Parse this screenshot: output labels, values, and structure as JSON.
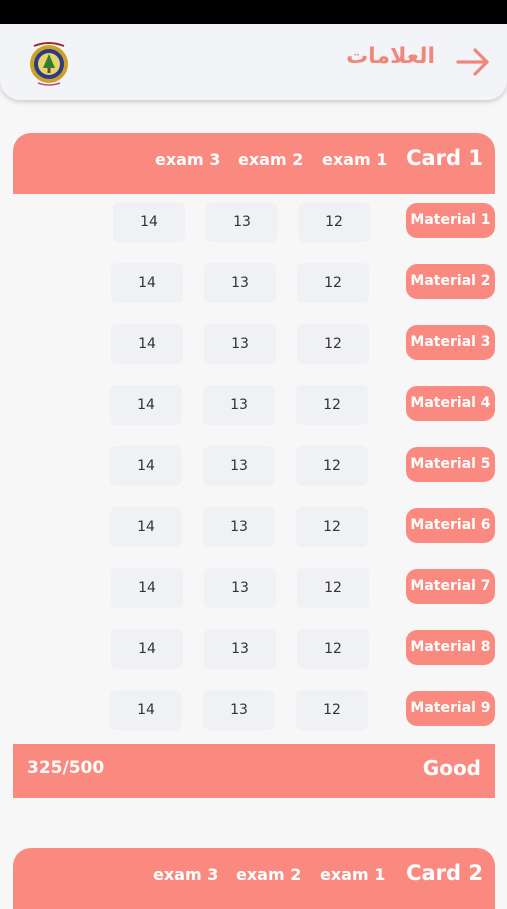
{
  "app_bar": {
    "title": "العلامات",
    "back_icon": "arrow-right-icon",
    "logo_icon": "school-emblem-icon"
  },
  "colors": {
    "accent": "#fa8a7f",
    "cell_bg": "#eff1f4",
    "background": "#f7f7f8"
  },
  "card1": {
    "title": "Card 1",
    "exam_headers": [
      "exam 1",
      "exam 2",
      "exam 3"
    ],
    "rows": [
      {
        "material": "Material 1",
        "grades": [
          "12",
          "13",
          "14"
        ]
      },
      {
        "material": "Material 2",
        "grades": [
          "12",
          "13",
          "14"
        ]
      },
      {
        "material": "Material 3",
        "grades": [
          "12",
          "13",
          "14"
        ]
      },
      {
        "material": "Material 4",
        "grades": [
          "12",
          "13",
          "14"
        ]
      },
      {
        "material": "Material 5",
        "grades": [
          "12",
          "13",
          "14"
        ]
      },
      {
        "material": "Material 6",
        "grades": [
          "12",
          "13",
          "14"
        ]
      },
      {
        "material": "Material 7",
        "grades": [
          "12",
          "13",
          "14"
        ]
      },
      {
        "material": "Material 8",
        "grades": [
          "12",
          "13",
          "14"
        ]
      },
      {
        "material": "Material 9",
        "grades": [
          "12",
          "13",
          "14"
        ]
      }
    ],
    "total": "325/500",
    "rating": "Good"
  },
  "card2": {
    "title": "Card 2",
    "exam_headers": [
      "exam 1",
      "exam 2",
      "exam 3"
    ]
  }
}
